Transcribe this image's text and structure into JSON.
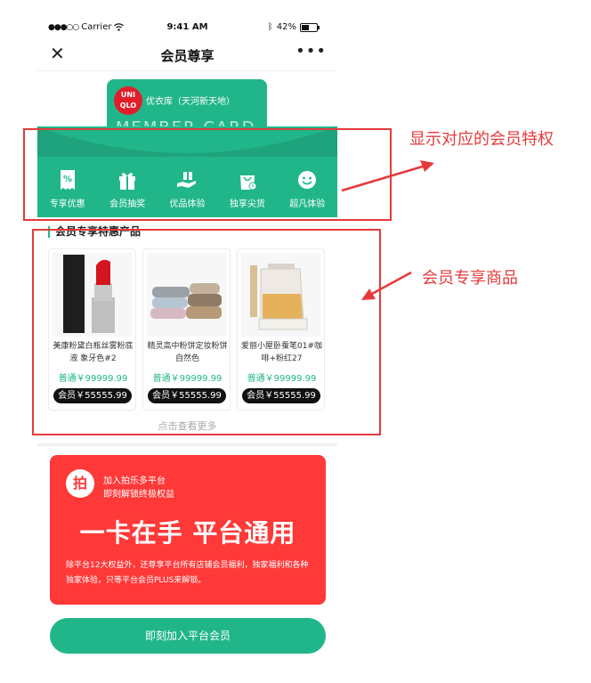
{
  "status_bar": {
    "carrier": "Carrier",
    "time": "9:41 AM",
    "battery": "42%"
  },
  "nav": {
    "title": "会员尊享",
    "close_icon": "close-icon",
    "more_icon": "more-icon"
  },
  "member_card": {
    "logo_text": "UNI QLO",
    "store_name": "优衣库（天河新天地）",
    "card_text": "MEMBER CARD"
  },
  "benefits": [
    {
      "label": "专享优惠",
      "icon": "discount-icon"
    },
    {
      "label": "会员抽奖",
      "icon": "gift-icon"
    },
    {
      "label": "优品体验",
      "icon": "gift-hand-icon"
    },
    {
      "label": "独享尖货",
      "icon": "shopping-bag-icon"
    },
    {
      "label": "超凡体验",
      "icon": "smile-icon"
    }
  ],
  "products_section": {
    "title": "会员专享特惠产品",
    "products": [
      {
        "name": "美康粉黛白瓶丝雾粉底液 象牙色#2",
        "regular_price": "普通￥99999.99",
        "member_price": "会员￥55555.99"
      },
      {
        "name": "精灵高中粉饼定妆粉饼 自然色",
        "regular_price": "普通￥99999.99",
        "member_price": "会员￥55555.99"
      },
      {
        "name": "爱丽小屋卧蚕笔01#咖啡+粉红27",
        "regular_price": "普通￥99999.99",
        "member_price": "会员￥55555.99"
      }
    ],
    "more_link": "点击查看更多"
  },
  "promo": {
    "icon_char": "拍",
    "line1": "加入拍乐多平台",
    "line2": "即刻解锁终极权益",
    "headline": "一卡在手 平台通用",
    "description": "除平台12大权益外，还尊享平台所有店铺会员福利，独家福利和各种独家体验，只等平台会员PLUS来解锁。"
  },
  "join_button": "即刻加入平台会员",
  "annotations": {
    "benefits_note": "显示对应的会员特权",
    "products_note": "会员专享商品"
  },
  "colors": {
    "brand_green": "#21b68a",
    "promo_red": "#ff3838",
    "annotation_red": "#e53a3a"
  }
}
